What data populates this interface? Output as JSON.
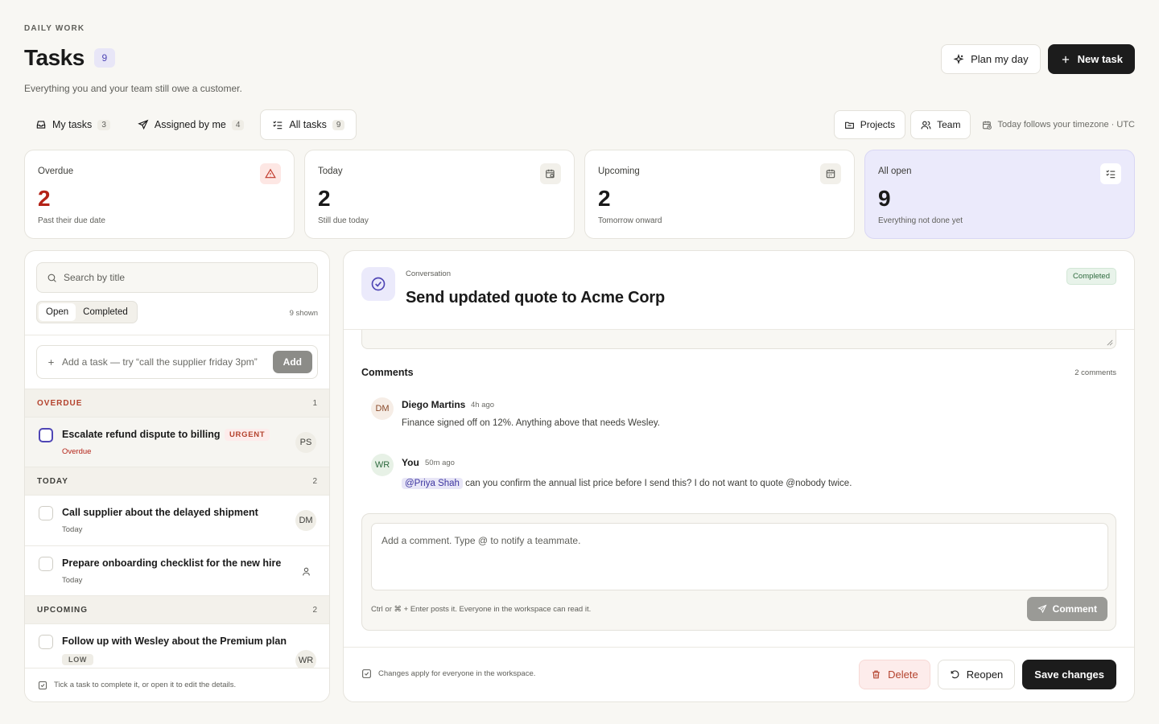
{
  "header": {
    "eyebrow": "DAILY WORK",
    "title": "Tasks",
    "count": "9",
    "subtitle": "Everything you and your team still owe a customer.",
    "plan_label": "Plan my day",
    "new_task_label": "New task"
  },
  "tabs": [
    {
      "label": "My tasks",
      "count": "3",
      "icon": "inbox-icon"
    },
    {
      "label": "Assigned by me",
      "count": "4",
      "icon": "send-icon"
    },
    {
      "label": "All tasks",
      "count": "9",
      "icon": "list-check-icon",
      "active": true
    }
  ],
  "right_controls": {
    "projects_label": "Projects",
    "team_label": "Team",
    "timezone_text": "Today follows your timezone · UTC"
  },
  "stats": [
    {
      "label": "Overdue",
      "value": "2",
      "sub": "Past their due date",
      "icon": "alert-triangle-icon"
    },
    {
      "label": "Today",
      "value": "2",
      "sub": "Still due today",
      "icon": "calendar-clock-icon"
    },
    {
      "label": "Upcoming",
      "value": "2",
      "sub": "Tomorrow onward",
      "icon": "calendar-icon"
    },
    {
      "label": "All open",
      "value": "9",
      "sub": "Everything not done yet",
      "icon": "list-check-icon"
    }
  ],
  "list": {
    "search_placeholder": "Search by title",
    "filter_open": "Open",
    "filter_completed": "Completed",
    "shown": "9 shown",
    "add_placeholder": "Add a task — try “call the supplier friday 3pm”",
    "add_button": "Add",
    "groups": [
      {
        "label": "OVERDUE",
        "count": "1"
      },
      {
        "label": "TODAY",
        "count": "2"
      },
      {
        "label": "UPCOMING",
        "count": "2"
      }
    ],
    "tasks": [
      {
        "title": "Escalate refund dispute to billing",
        "due": "Overdue",
        "badge": "URGENT",
        "assignee": "PS"
      },
      {
        "title": "Call supplier about the delayed shipment",
        "due": "Today",
        "assignee": "DM"
      },
      {
        "title": "Prepare onboarding checklist for the new hire",
        "due": "Today",
        "assignee": ""
      },
      {
        "title": "Follow up with Wesley about the Premium plan",
        "badge": "LOW",
        "assignee": "WR"
      }
    ],
    "footer_hint": "Tick a task to complete it, or open it to edit the details."
  },
  "detail": {
    "kicker": "Conversation",
    "title": "Send updated quote to Acme Corp",
    "status": "Completed",
    "comments_heading": "Comments",
    "comments_count": "2 comments",
    "comments": [
      {
        "initials": "DM",
        "author": "Diego Martins",
        "time": "4h ago",
        "text": "Finance signed off on 12%. Anything above that needs Wesley."
      },
      {
        "initials": "WR",
        "author": "You",
        "time": "50m ago",
        "mention": "@Priya Shah",
        "text": "can you confirm the annual list price before I send this? I do not want to quote @nobody twice."
      }
    ],
    "composer_placeholder": "Add a comment. Type @ to notify a teammate.",
    "composer_hint": "Ctrl or ⌘ + Enter posts it. Everyone in the workspace can read it.",
    "comment_button": "Comment",
    "footer_note": "Changes apply for everyone in the workspace.",
    "delete_label": "Delete",
    "reopen_label": "Reopen",
    "save_label": "Save changes"
  }
}
